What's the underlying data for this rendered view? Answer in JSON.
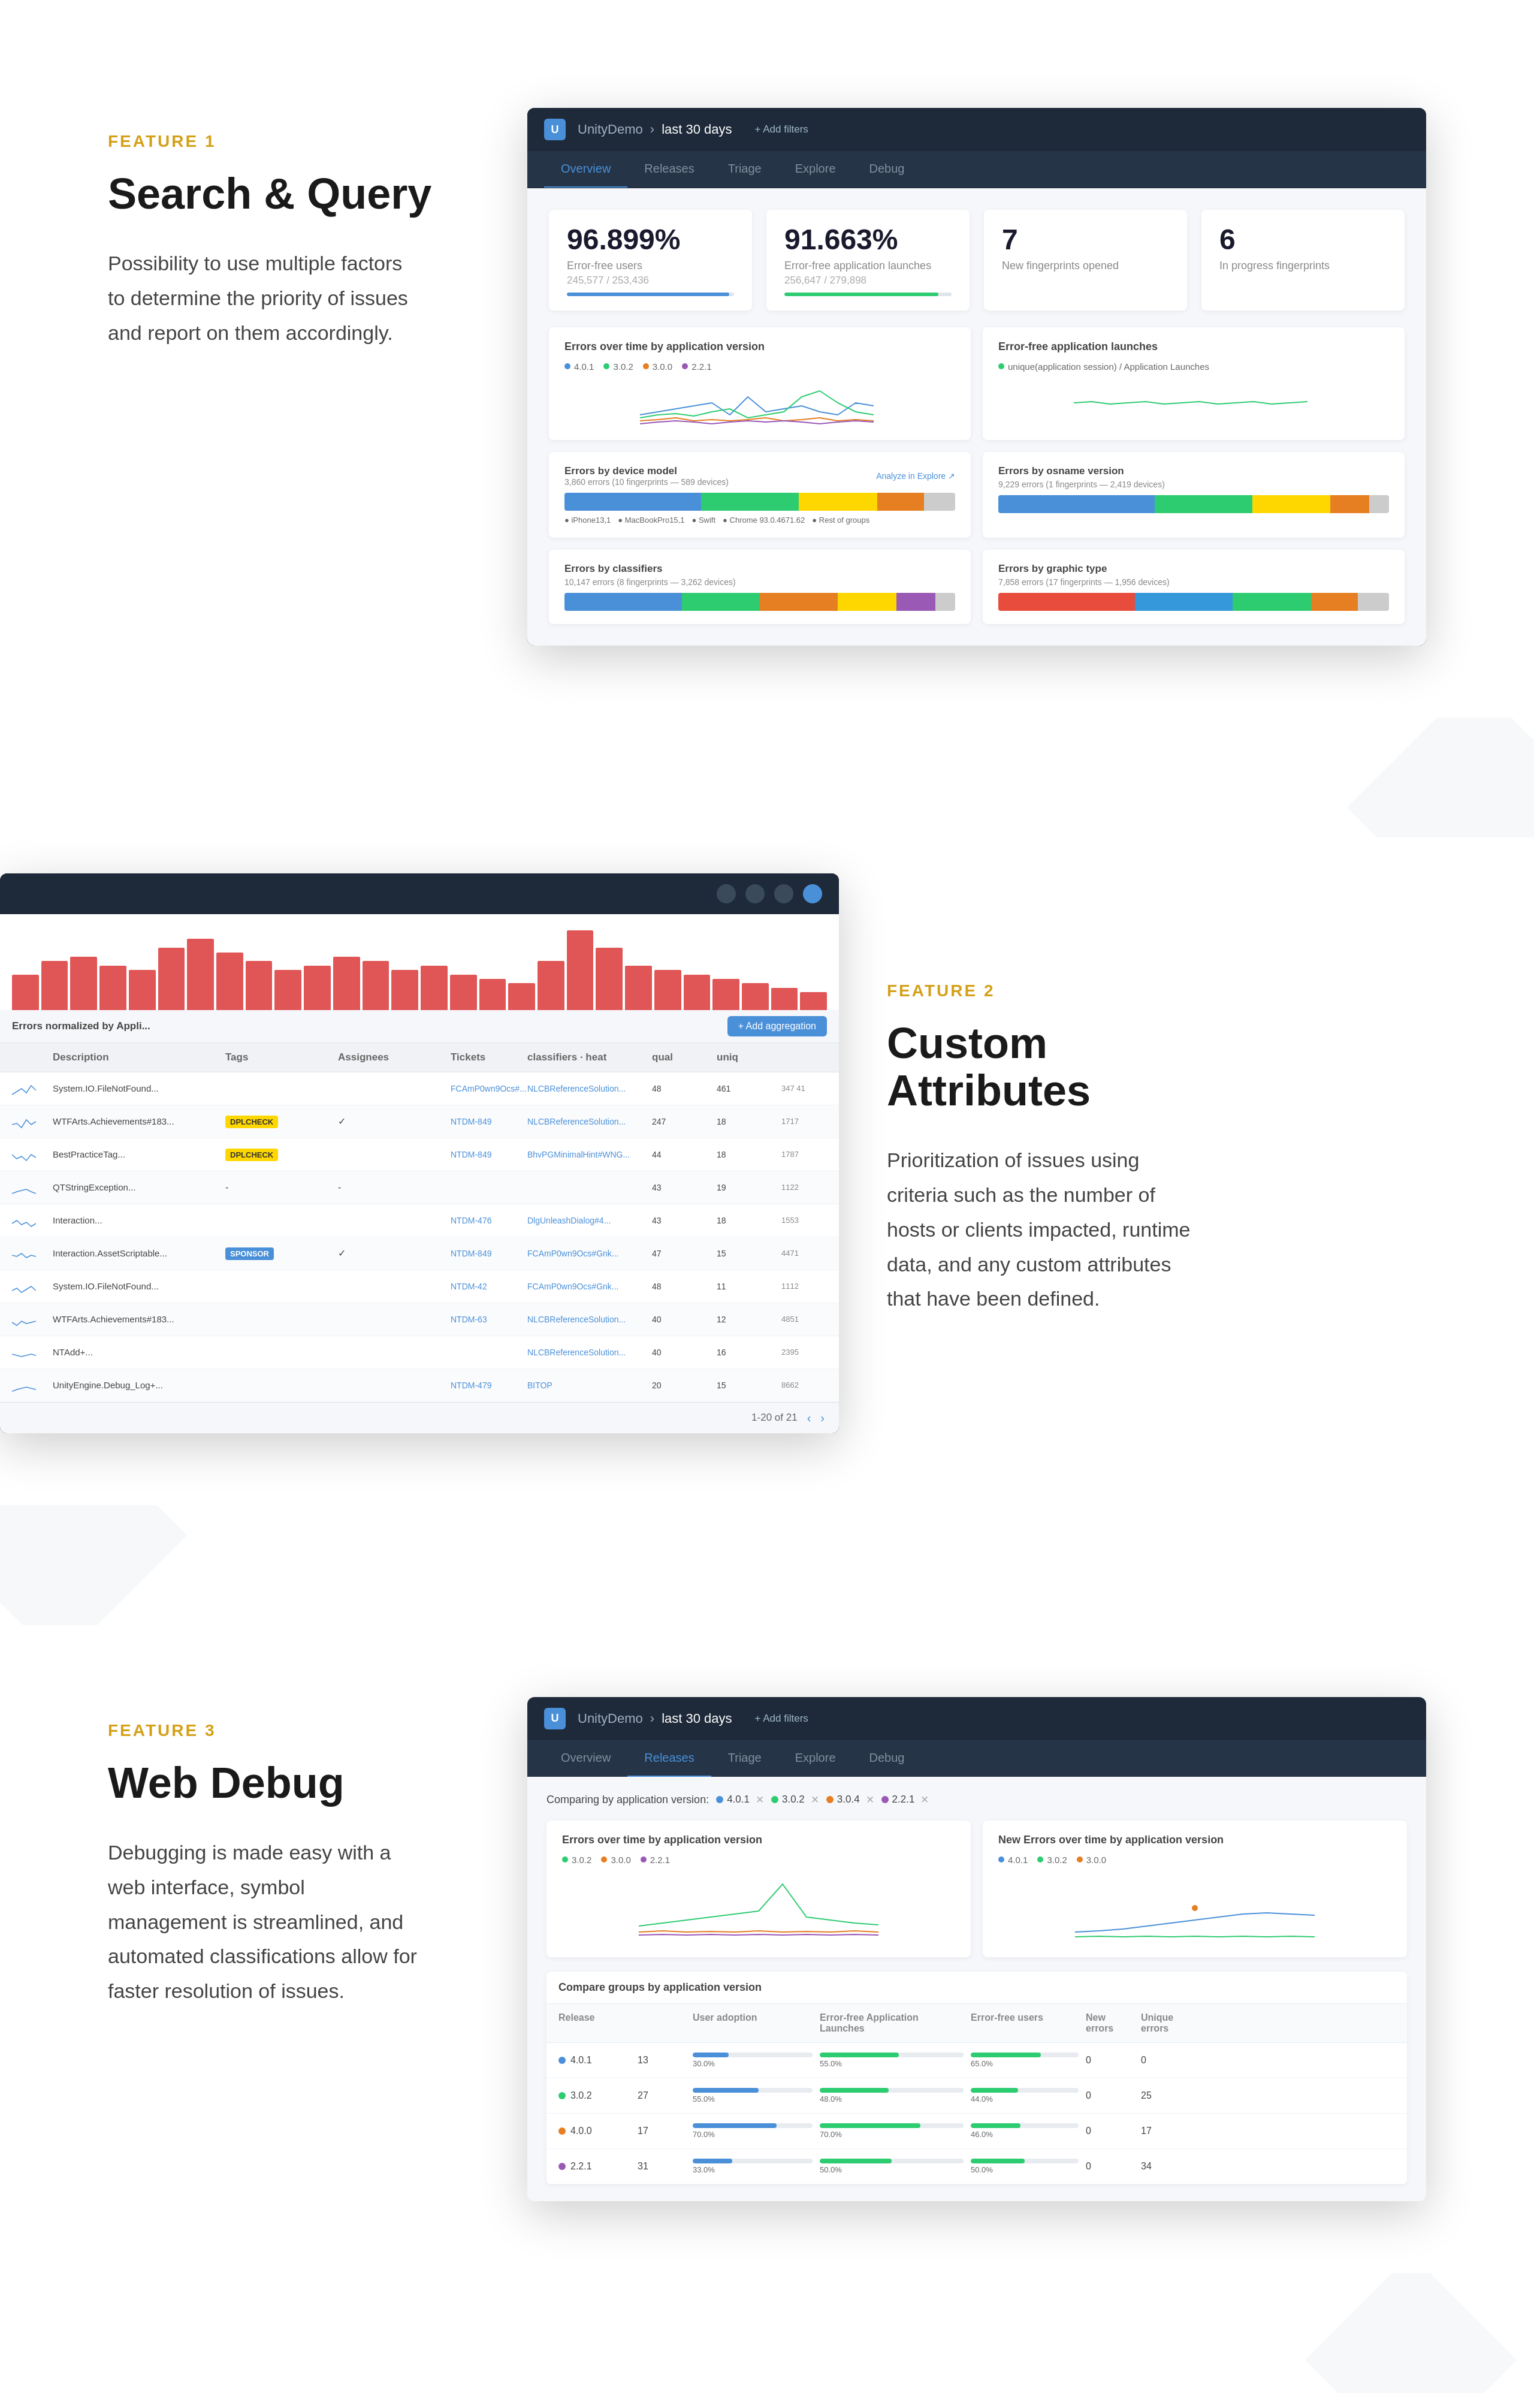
{
  "page": {
    "background": "#ffffff"
  },
  "section1": {
    "feature_label": "FEATURE 1",
    "title": "Search & Query",
    "description": "Possibility to use multiple factors to determine the priority of issues and report on them accordingly.",
    "dashboard": {
      "logo_text": "U",
      "breadcrumb_app": "UnityDemo",
      "breadcrumb_sep": "›",
      "breadcrumb_date": "last 30 days",
      "filter_btn": "+ Add filters",
      "nav_items": [
        "Overview",
        "Releases",
        "Triage",
        "Explore",
        "Debug"
      ],
      "active_nav": "Overview",
      "metrics": [
        {
          "value": "96.899%",
          "label": "Error-free users",
          "sub": "245,577 / 253,436",
          "bar_pct": 97,
          "bar_color": "#4a90d9"
        },
        {
          "value": "91.663%",
          "label": "Error-free application launches",
          "sub": "256,647 / 279,898",
          "bar_pct": 92,
          "bar_color": "#2ecc71"
        },
        {
          "value": "7",
          "label": "New fingerprints opened",
          "sub": "",
          "bar_pct": 0,
          "bar_color": ""
        },
        {
          "value": "6",
          "label": "In progress fingerprints",
          "sub": "",
          "bar_pct": 0,
          "bar_color": ""
        }
      ],
      "chart1_title": "Errors over time by application version",
      "chart1_legend": [
        "4.0.1",
        "3.0.2",
        "3.0.0",
        "2.2.1"
      ],
      "chart1_colors": [
        "#4a90d9",
        "#2ecc71",
        "#e67e22",
        "#9b59b6"
      ],
      "chart2_title": "Error-free application launches",
      "chart2_legend": [
        "unique(application session) / Application Launches"
      ],
      "chart2_colors": [
        "#2ecc71"
      ],
      "errors_device_title": "Errors by device model",
      "errors_device_sub": "3,860 errors (10 fingerprints — 589 devices)",
      "errors_device_link": "Analyze in Explore ↗",
      "errors_version_title": "Errors by osname version",
      "errors_version_sub": "9,229 errors (1 fingerprints — 2,419 devices)",
      "errors_classifiers_title": "Errors by classifiers",
      "errors_classifiers_sub": "10,147 errors (8 fingerprints — 3,262 devices)",
      "errors_graphic_title": "Errors by graphic type",
      "errors_graphic_sub": "7,858 errors (17 fingerprints — 1,956 devices)"
    }
  },
  "section2": {
    "feature_label": "FEATURE 2",
    "title": "Custom Attributes",
    "description": "Prioritization of issues using criteria such as the number of hosts or clients impacted, runtime data, and any custom attributes that have been defined.",
    "table": {
      "title": "Errors normalized by Appli...",
      "header": [
        "",
        "Description",
        "Tags",
        "Assignees",
        "Tickets",
        "classifiers · heat",
        "qual · uniq",
        "",
        ""
      ],
      "add_btn": "+ Add aggregation",
      "rows": [
        {
          "spark": true,
          "desc": "System.IO.FileNotFound...",
          "tags": "",
          "assignees": "",
          "tickets": "FCAmP0wn9Ocs#...",
          "classifiers": "NLCBReferenceSolution...",
          "qual": "48",
          "uniq": "461",
          "counts": "347 41"
        },
        {
          "spark": true,
          "desc": "WTFArts.Achievements#183...",
          "tags": "DPLCHECK",
          "assignees": "✓",
          "tickets": "NTDM-849",
          "classifiers": "NLCBReferenceSolution...",
          "qual": "247",
          "uniq": "18 1717",
          "counts": ""
        },
        {
          "spark": true,
          "desc": "BestPracticeTag...",
          "tags": "DPLCHECK",
          "assignees": "",
          "tickets": "NTDM-849",
          "classifiers": "BhvPGMinimalHint#WNG...",
          "qual": "44",
          "uniq": "18 1787",
          "counts": ""
        },
        {
          "spark": true,
          "desc": "QTStringException...",
          "tags": "",
          "assignees": "",
          "tickets": "",
          "classifiers": "",
          "qual": "43",
          "uniq": "19 1122",
          "counts": ""
        },
        {
          "spark": true,
          "desc": "Interaction...",
          "tags": "",
          "assignees": "",
          "tickets": "NTDM-476",
          "classifiers": "DlgUnleashDialog#4...",
          "qual": "43",
          "uniq": "18 1553",
          "counts": ""
        },
        {
          "spark": true,
          "desc": "Interaction.AssetScriptable...",
          "tags": "SPONSOR",
          "assignees": "✓",
          "tickets": "NTDM-849",
          "classifiers": "FCAmP0wn9Ocs#Gnk...",
          "qual": "47",
          "uniq": "15 4471",
          "counts": ""
        },
        {
          "spark": true,
          "desc": "System.IO.FileNotFound...",
          "tags": "",
          "assignees": "",
          "tickets": "NTDM-42",
          "classifiers": "FCAmP0wn9Ocs#Gnk...",
          "qual": "48",
          "uniq": "11 1112",
          "counts": ""
        },
        {
          "spark": true,
          "desc": "WTFArts.Achievements#183...",
          "tags": "",
          "assignees": "",
          "tickets": "NTDM-63",
          "classifiers": "NLCBReferenceSolution...",
          "qual": "40",
          "uniq": "12 4851",
          "counts": ""
        },
        {
          "spark": true,
          "desc": "NTAdd+...",
          "tags": "",
          "assignees": "",
          "tickets": "",
          "classifiers": "NLCBReferenceSolution...",
          "qual": "40",
          "uniq": "16 2395",
          "counts": ""
        },
        {
          "spark": true,
          "desc": "UnityEngine.Debug_Log+...",
          "tags": "",
          "assignees": "",
          "tickets": "NTDM-479",
          "classifiers": "BITOP",
          "qual": "20",
          "uniq": "15 8662",
          "counts": ""
        }
      ],
      "pagination": "1-20 of 21",
      "pagination_prev": "‹",
      "pagination_next": "›"
    }
  },
  "section3": {
    "feature_label": "FEATURE 3",
    "title": "Web Debug",
    "description": "Debugging is made easy with a web interface, symbol management is streamlined, and automated classifications allow for faster resolution of issues.",
    "releases": {
      "breadcrumb_app": "UnityDemo",
      "breadcrumb_date": "last 30 days",
      "nav_items": [
        "Overview",
        "Releases",
        "Triage",
        "Explore",
        "Debug"
      ],
      "active_nav": "Releases",
      "comparing_label": "Comparing by application version:",
      "versions": [
        "4.0.1",
        "3.0.2",
        "3.0.4",
        "2.2.1"
      ],
      "version_colors": [
        "#4a90d9",
        "#2ecc71",
        "#e67e22",
        "#9b59b6"
      ],
      "chart_left_title": "Errors over time by application version",
      "chart_left_legend": [
        "3.0.2",
        "3.0.0",
        "2.2.1"
      ],
      "chart_left_colors": [
        "#2ecc71",
        "#e67e22",
        "#9b59b6"
      ],
      "chart_right_title": "New Errors over time by application version",
      "chart_right_legend": [
        "4.0.1",
        "3.0.2",
        "3.0.0"
      ],
      "chart_right_colors": [
        "#4a90d9",
        "#2ecc71",
        "#e67e22"
      ],
      "table_headers": [
        "Release",
        "",
        "User adoption",
        "Error-free Application Launches",
        "Error-free users",
        "New errors",
        "Unique errors"
      ],
      "table_rows": [
        {
          "version": "4.0.1",
          "color": "#4a90d9",
          "num": "13",
          "adoption": 30,
          "ef_launches": 55,
          "ef_users": 65,
          "new_errors": "0",
          "unique_errors": "0"
        },
        {
          "version": "3.0.2",
          "color": "#2ecc71",
          "num": "27",
          "adoption": 55,
          "ef_launches": 48,
          "ef_users": 44,
          "new_errors": "0",
          "unique_errors": "25"
        },
        {
          "version": "4.0.0",
          "color": "#e67e22",
          "num": "17",
          "adoption": 70,
          "ef_launches": 70,
          "ef_users": 46,
          "new_errors": "0",
          "unique_errors": "17"
        },
        {
          "version": "2.2.1",
          "color": "#9b59b6",
          "num": "31",
          "adoption": 33,
          "ef_launches": 50,
          "ef_users": 50,
          "new_errors": "0",
          "unique_errors": "34"
        }
      ]
    }
  },
  "icons": {
    "unity": "U",
    "chevron_down": "▾",
    "filter": "⚙",
    "prev": "‹",
    "next": "›",
    "close": "✕",
    "check": "✓",
    "plus": "+"
  }
}
